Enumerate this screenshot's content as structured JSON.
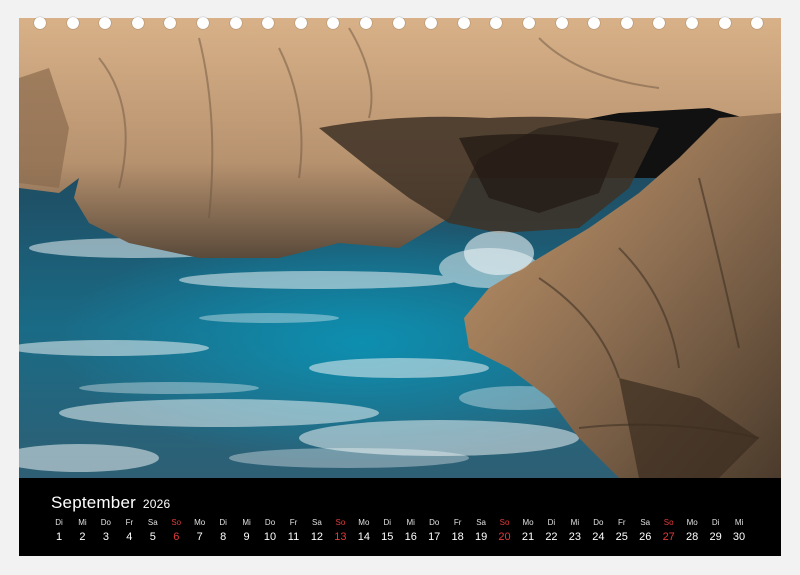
{
  "calendar": {
    "month": "September",
    "year": "2026",
    "days": [
      {
        "dn": "Di",
        "dd": "1"
      },
      {
        "dn": "Mi",
        "dd": "2"
      },
      {
        "dn": "Do",
        "dd": "3"
      },
      {
        "dn": "Fr",
        "dd": "4"
      },
      {
        "dn": "Sa",
        "dd": "5"
      },
      {
        "dn": "So",
        "dd": "6",
        "sunday": true
      },
      {
        "dn": "Mo",
        "dd": "7"
      },
      {
        "dn": "Di",
        "dd": "8"
      },
      {
        "dn": "Mi",
        "dd": "9"
      },
      {
        "dn": "Do",
        "dd": "10"
      },
      {
        "dn": "Fr",
        "dd": "11"
      },
      {
        "dn": "Sa",
        "dd": "12"
      },
      {
        "dn": "So",
        "dd": "13",
        "sunday": true
      },
      {
        "dn": "Mo",
        "dd": "14"
      },
      {
        "dn": "Di",
        "dd": "15"
      },
      {
        "dn": "Mi",
        "dd": "16"
      },
      {
        "dn": "Do",
        "dd": "17"
      },
      {
        "dn": "Fr",
        "dd": "18"
      },
      {
        "dn": "Sa",
        "dd": "19"
      },
      {
        "dn": "So",
        "dd": "20",
        "sunday": true
      },
      {
        "dn": "Mo",
        "dd": "21"
      },
      {
        "dn": "Di",
        "dd": "22"
      },
      {
        "dn": "Mi",
        "dd": "23"
      },
      {
        "dn": "Do",
        "dd": "24"
      },
      {
        "dn": "Fr",
        "dd": "25"
      },
      {
        "dn": "Sa",
        "dd": "26"
      },
      {
        "dn": "So",
        "dd": "27",
        "sunday": true
      },
      {
        "dn": "Mo",
        "dd": "28"
      },
      {
        "dn": "Di",
        "dd": "29"
      },
      {
        "dn": "Mi",
        "dd": "30"
      }
    ]
  },
  "colors": {
    "sunday": "#e23a3a",
    "bar": "#000000",
    "text": "#ffffff"
  },
  "binding_holes": 23
}
